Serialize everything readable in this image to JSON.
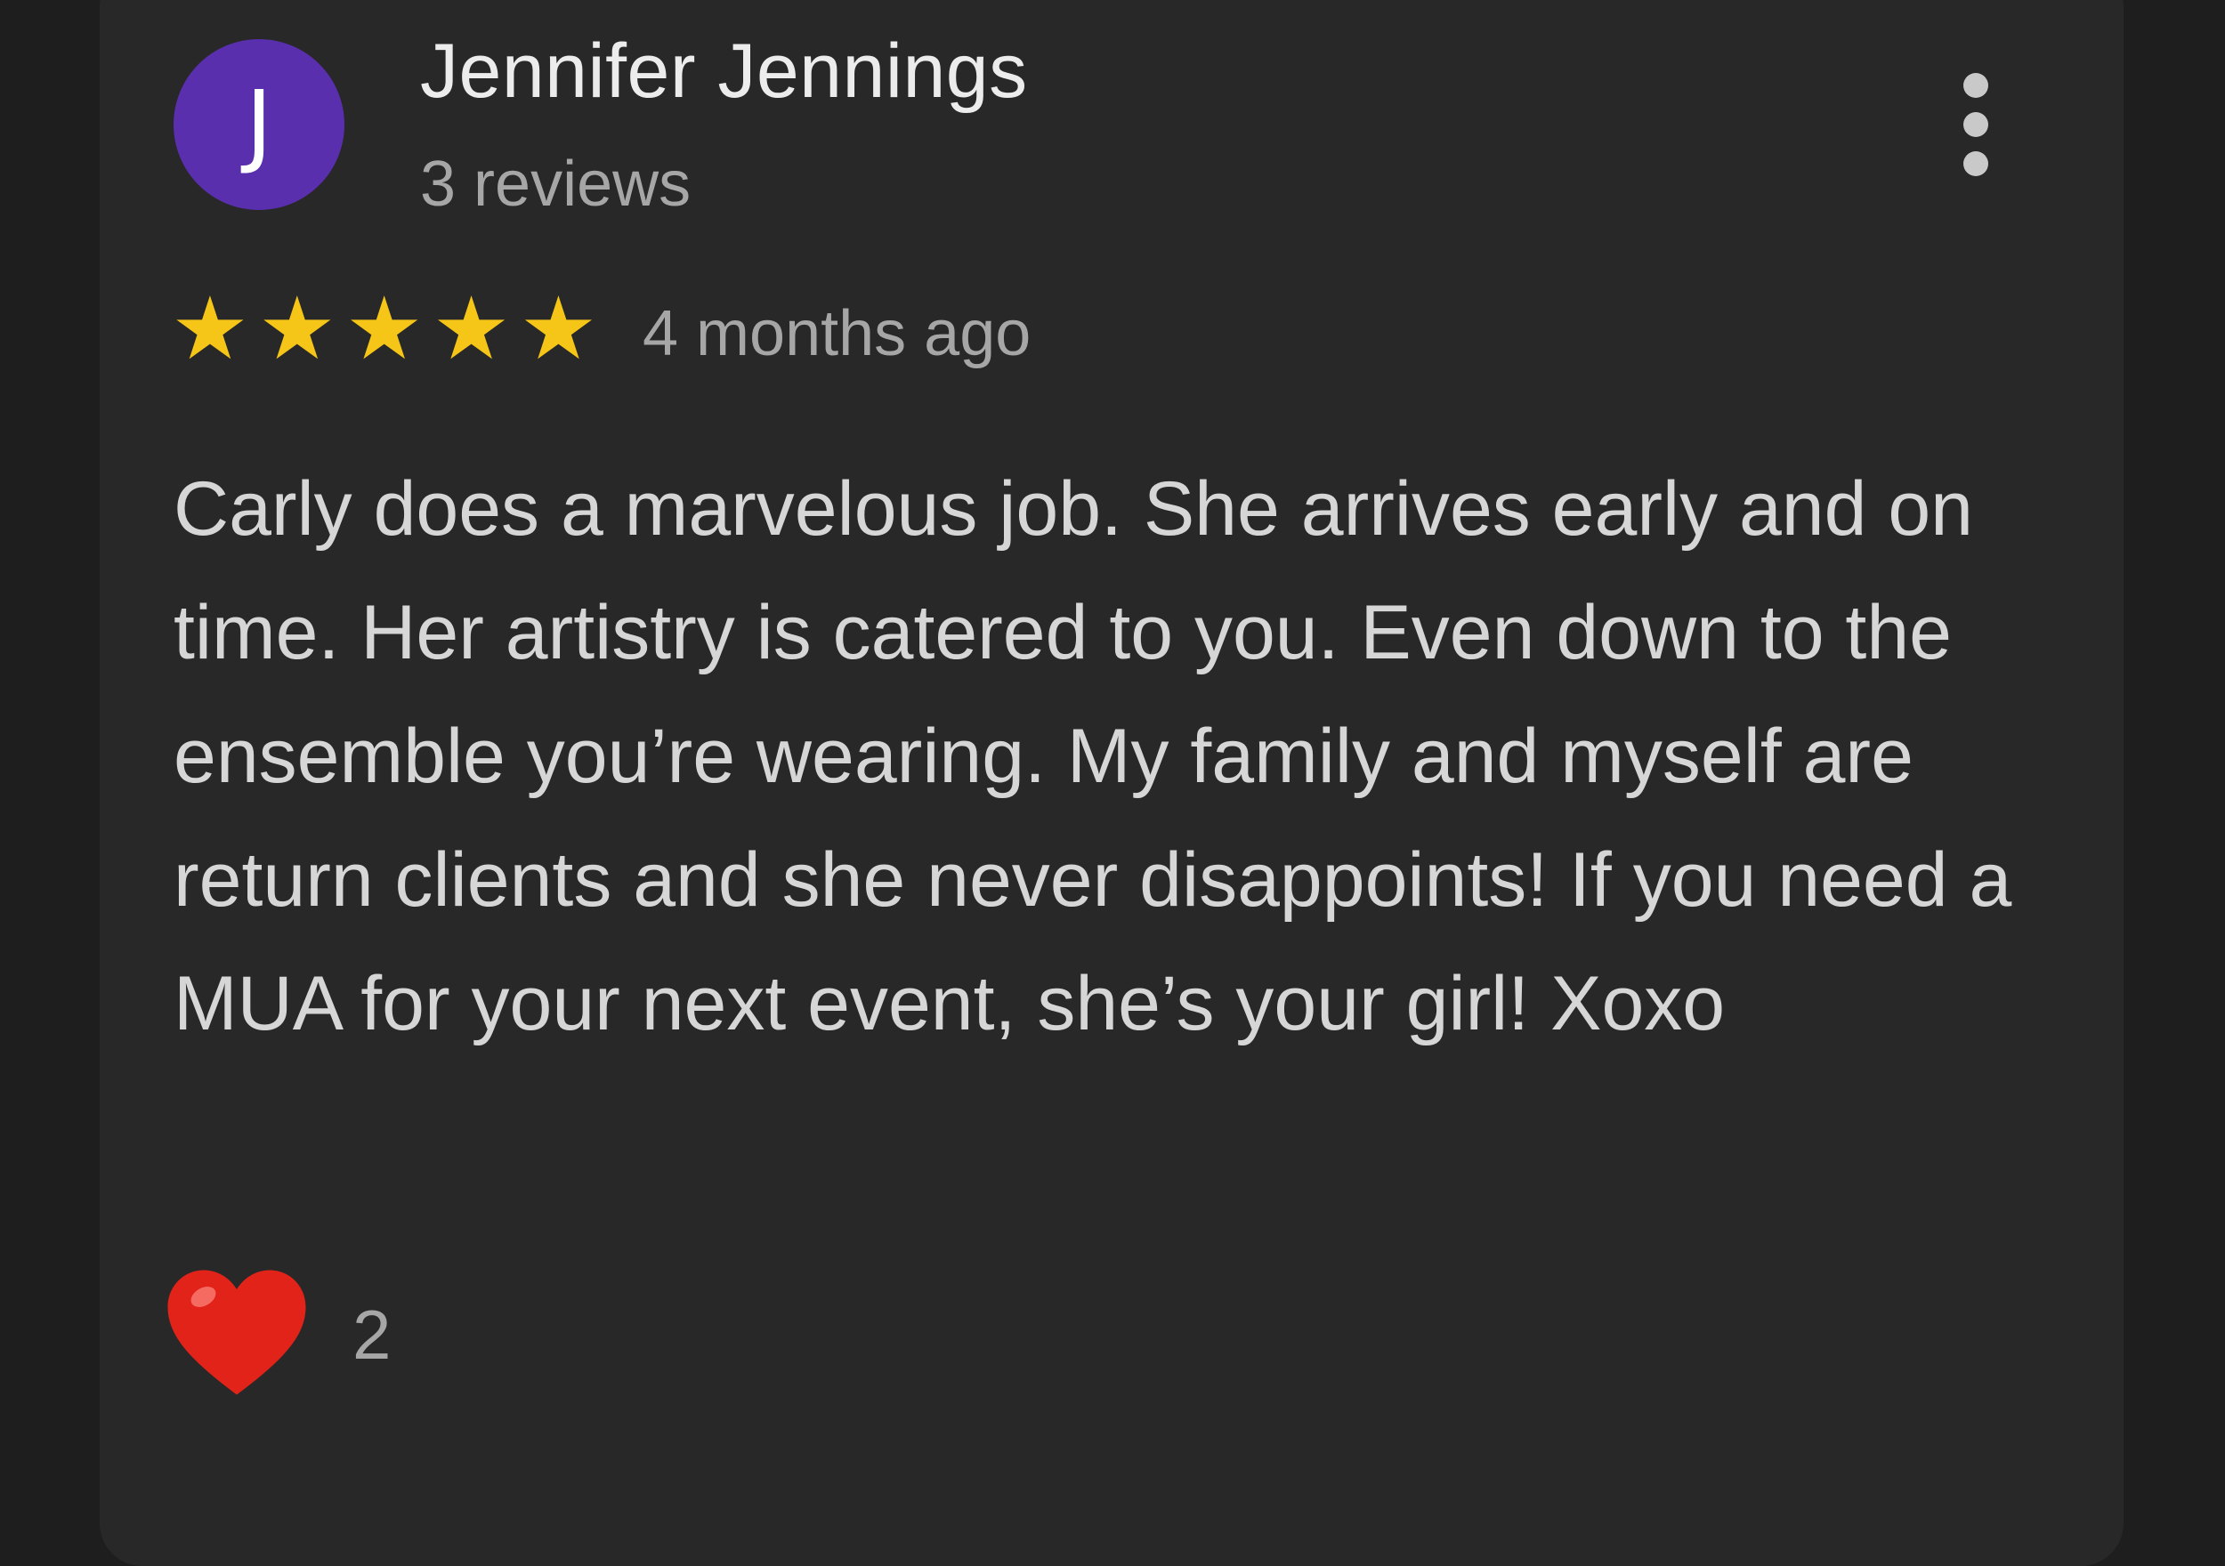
{
  "review": {
    "avatar_initial": "J",
    "reviewer_name": "Jennifer Jennings",
    "review_count": "3 reviews",
    "rating": 5,
    "max_rating": 5,
    "time_ago": "4 months ago",
    "text": "Carly does a marvelous job. She arrives early and on time. Her artistry is catered to you. Even down to the ensemble you’re wearing. My family and myself are return clients and she never disappoints! If you need a MUA for your next event, she’s your girl! Xoxo",
    "reaction_icon": "heart-icon",
    "reaction_count": "2",
    "more_icon": "more-vert-icon"
  },
  "colors": {
    "background": "#1e1e1e",
    "card": "#282828",
    "avatar": "#5a2fae",
    "star": "#f5c518",
    "heart": "#e2231a",
    "primary_text": "#ececec",
    "secondary_text": "#a6a6a6"
  }
}
